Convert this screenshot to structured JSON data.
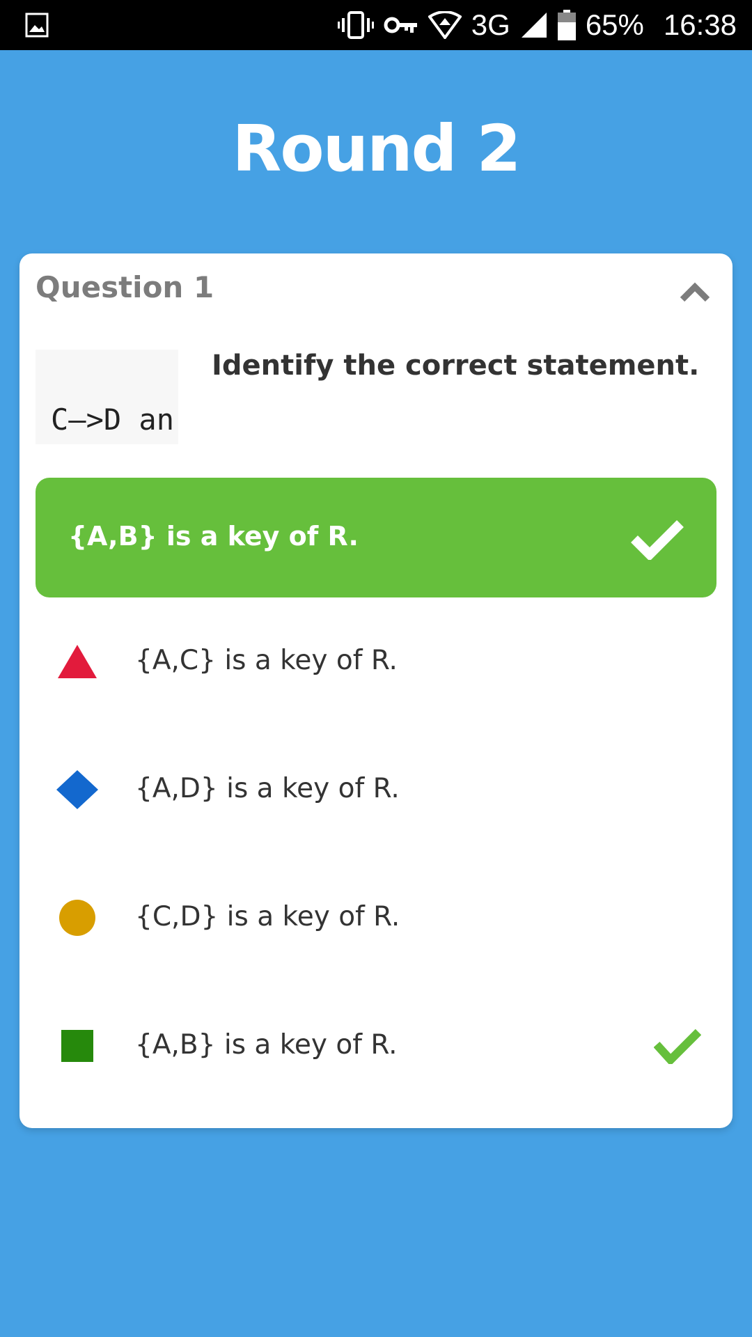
{
  "status_bar": {
    "battery_percent": "65%",
    "time": "16:38",
    "network": "3G",
    "icons": [
      "image-icon",
      "vibrate-icon",
      "vpn-key-icon",
      "wifi-icon",
      "signal-icon",
      "battery-icon"
    ]
  },
  "header": {
    "title": "Round 2"
  },
  "question": {
    "label": "Question 1",
    "code_snippet": "C–>D an",
    "text": "Identify the correct statement."
  },
  "selected_answer": {
    "text": "{A,B} is a key of R.",
    "color": "#66bf3c"
  },
  "options": [
    {
      "shape": "triangle",
      "color": "#e21b3c",
      "text": "{A,C} is a key of R.",
      "correct": false
    },
    {
      "shape": "diamond",
      "color": "#1368ce",
      "text": "{A,D} is a key of R.",
      "correct": false
    },
    {
      "shape": "circle",
      "color": "#d89e00",
      "text": "{C,D} is a key of R.",
      "correct": false
    },
    {
      "shape": "square",
      "color": "#26890c",
      "text": "{A,B} is a key of R.",
      "correct": true
    }
  ],
  "colors": {
    "background": "#46a1e4",
    "card": "#ffffff",
    "correct": "#66bf3c"
  }
}
